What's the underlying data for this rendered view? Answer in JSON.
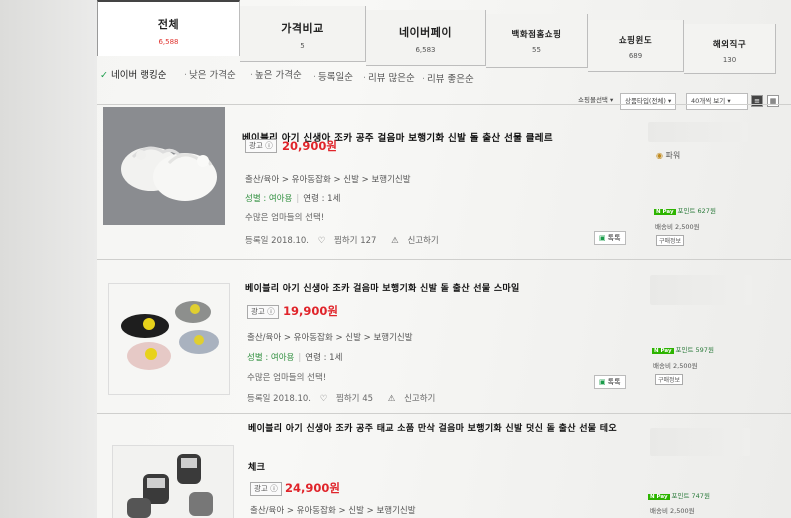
{
  "tabs": [
    {
      "label": "전체",
      "count": "6,588"
    },
    {
      "label": "가격비교",
      "count": "5"
    },
    {
      "label": "네이버페이",
      "count": "6,583"
    },
    {
      "label": "백화점홈쇼핑",
      "count": "55"
    },
    {
      "label": "쇼핑윈도",
      "count": "689"
    },
    {
      "label": "해외직구",
      "count": "130"
    }
  ],
  "sort": {
    "options": [
      "네이버 랭킹순",
      "낮은 가격순",
      "높은 가격순",
      "등록일순",
      "리뷰 많은순",
      "리뷰 좋은순"
    ],
    "selected": "네이버 랭킹순"
  },
  "filters": {
    "shop_type_label": "쇼핑몰선택",
    "product_type": "상품타입(전체)",
    "per_page": "40개씩 보기"
  },
  "products": [
    {
      "title": "베이블리 아기 신생아 조카 공주 걸음마 보행기화 신발 돌 출산 선물 클레르",
      "ad": "광고",
      "price": "20,900원",
      "category": "출산/육아 > 유아동잡화 > 신발 > 보행기신발",
      "gender_label": "성별 : 여아용",
      "age_label": "연령 : 1세",
      "desc": "수많은 엄마들의 선택!",
      "reg": "등록일 2018.10.",
      "zzim": "찜하기 127",
      "report": "신고하기",
      "talk": "톡톡",
      "badge": "파워",
      "points": "포인트 627원",
      "shipping": "배송비 2,500원",
      "buy_info": "구매정보"
    },
    {
      "title": "베이블리 아기 신생아 조카 걸음마 보행기화 신발 돌 출산 선물 스마일",
      "ad": "광고",
      "price": "19,900원",
      "category": "출산/육아 > 유아동잡화 > 신발 > 보행기신발",
      "gender_label": "성별 : 여아용",
      "age_label": "연령 : 1세",
      "desc": "수많은 엄마들의 선택!",
      "reg": "등록일 2018.10.",
      "zzim": "찜하기 45",
      "report": "신고하기",
      "talk": "톡톡",
      "points": "포인트 597원",
      "shipping": "배송비 2,500원",
      "buy_info": "구매정보"
    },
    {
      "title_line1": "베이블리 아기 신생아 조카 공주 태교 소품 만삭 걸음마 보행기화 신발 덧신 돌 출산 선물 테오",
      "title_line2": "체크",
      "ad": "광고",
      "price": "24,900원",
      "category": "출산/육아 > 유아동잡화 > 신발 > 보행기신발",
      "points": "포인트 747원",
      "shipping": "배송비 2,500원"
    }
  ],
  "npay": "N Pay"
}
